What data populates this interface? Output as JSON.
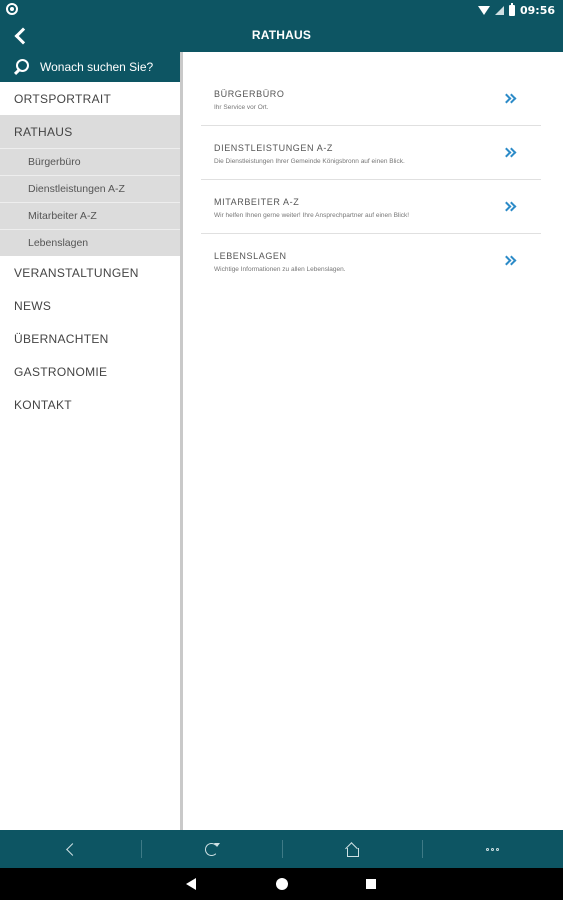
{
  "status_bar": {
    "time": "09:56"
  },
  "header": {
    "title": "RATHAUS"
  },
  "search": {
    "placeholder": "Wonach suchen Sie?"
  },
  "sidebar": {
    "items": [
      {
        "label": "ORTSPORTRAIT",
        "active": false
      },
      {
        "label": "RATHAUS",
        "active": true
      },
      {
        "label": "VERANSTALTUNGEN",
        "active": false
      },
      {
        "label": "NEWS",
        "active": false
      },
      {
        "label": "ÜBERNACHTEN",
        "active": false
      },
      {
        "label": "GASTRONOMIE",
        "active": false
      },
      {
        "label": "KONTAKT",
        "active": false
      }
    ],
    "sub_items": [
      {
        "label": "Bürgerbüro"
      },
      {
        "label": "Dienstleistungen A-Z"
      },
      {
        "label": "Mitarbeiter A-Z"
      },
      {
        "label": "Lebenslagen"
      }
    ]
  },
  "content": {
    "items": [
      {
        "title": "BÜRGERBÜRO",
        "description": "Ihr Service vor Ort."
      },
      {
        "title": "DIENSTLEISTUNGEN A-Z",
        "description": "Die Dienstleistungen Ihrer Gemeinde Königsbronn auf einen Blick."
      },
      {
        "title": "MITARBEITER A-Z",
        "description": "Wir helfen Ihnen gerne weiter! Ihre Ansprechpartner auf einen Blick!"
      },
      {
        "title": "LEBENSLAGEN",
        "description": "Wichtige Informationen zu allen Lebenslagen."
      }
    ]
  },
  "colors": {
    "primary": "#0d5563",
    "active_bg": "#dcdcdc",
    "accent": "#2c8bc8"
  }
}
